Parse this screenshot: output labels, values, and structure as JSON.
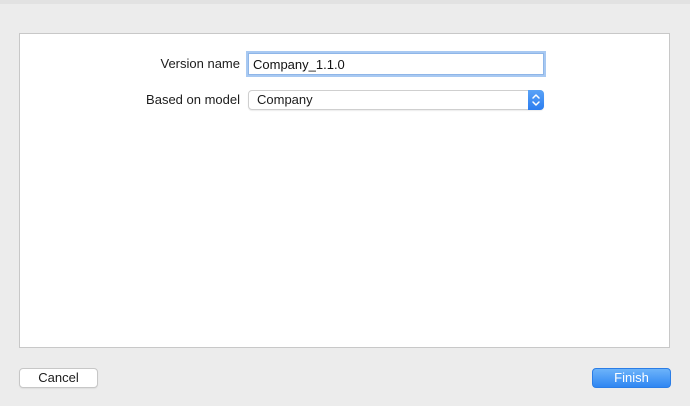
{
  "form": {
    "version_name": {
      "label": "Version name",
      "value": "Company_1.1.0"
    },
    "based_on_model": {
      "label": "Based on model",
      "selected": "Company"
    }
  },
  "buttons": {
    "cancel_label": "Cancel",
    "finish_label": "Finish"
  },
  "colors": {
    "accent": "#2f86f2",
    "focus_ring": "#a8c9f2",
    "window_bg": "#ececec",
    "panel_bg": "#ffffff"
  },
  "icons": {
    "popup_indicator": "chevron-up-down-icon"
  }
}
